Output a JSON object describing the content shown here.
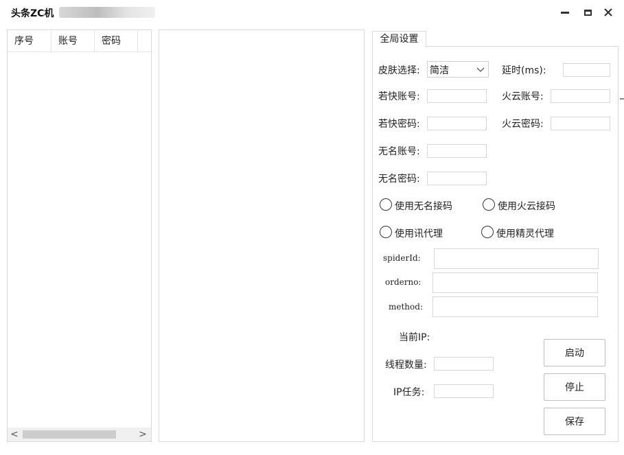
{
  "window": {
    "title": "头条ZC机"
  },
  "grid": {
    "columns": [
      "序号",
      "账号",
      "密码"
    ]
  },
  "tabs": [
    {
      "label": "全局设置"
    }
  ],
  "settings": {
    "skin_label": "皮肤选择:",
    "skin_value": "简洁",
    "delay_label": "延时(ms):",
    "delay_value": "",
    "ruokuai_account_label": "若快账号:",
    "ruokuai_password_label": "若快密码:",
    "huoyun_account_label": "火云账号:",
    "huoyun_password_label": "火云密码:",
    "wuming_account_label": "无名账号:",
    "wuming_password_label": "无名密码:",
    "radio_wuming": "使用无名接码",
    "radio_huoyun": "使用火云接码",
    "radio_xun": "使用讯代理",
    "radio_jingling": "使用精灵代理",
    "spiderid_label": "spiderId:",
    "orderno_label": "orderno:",
    "method_label": "method:",
    "current_ip_label": "当前IP:",
    "threads_label": "线程数量:",
    "ip_task_label": "IP任务:"
  },
  "buttons": {
    "start": "启动",
    "stop": "停止",
    "save": "保存"
  },
  "scroll": {
    "left_arrow": "<",
    "right_arrow": ">"
  }
}
